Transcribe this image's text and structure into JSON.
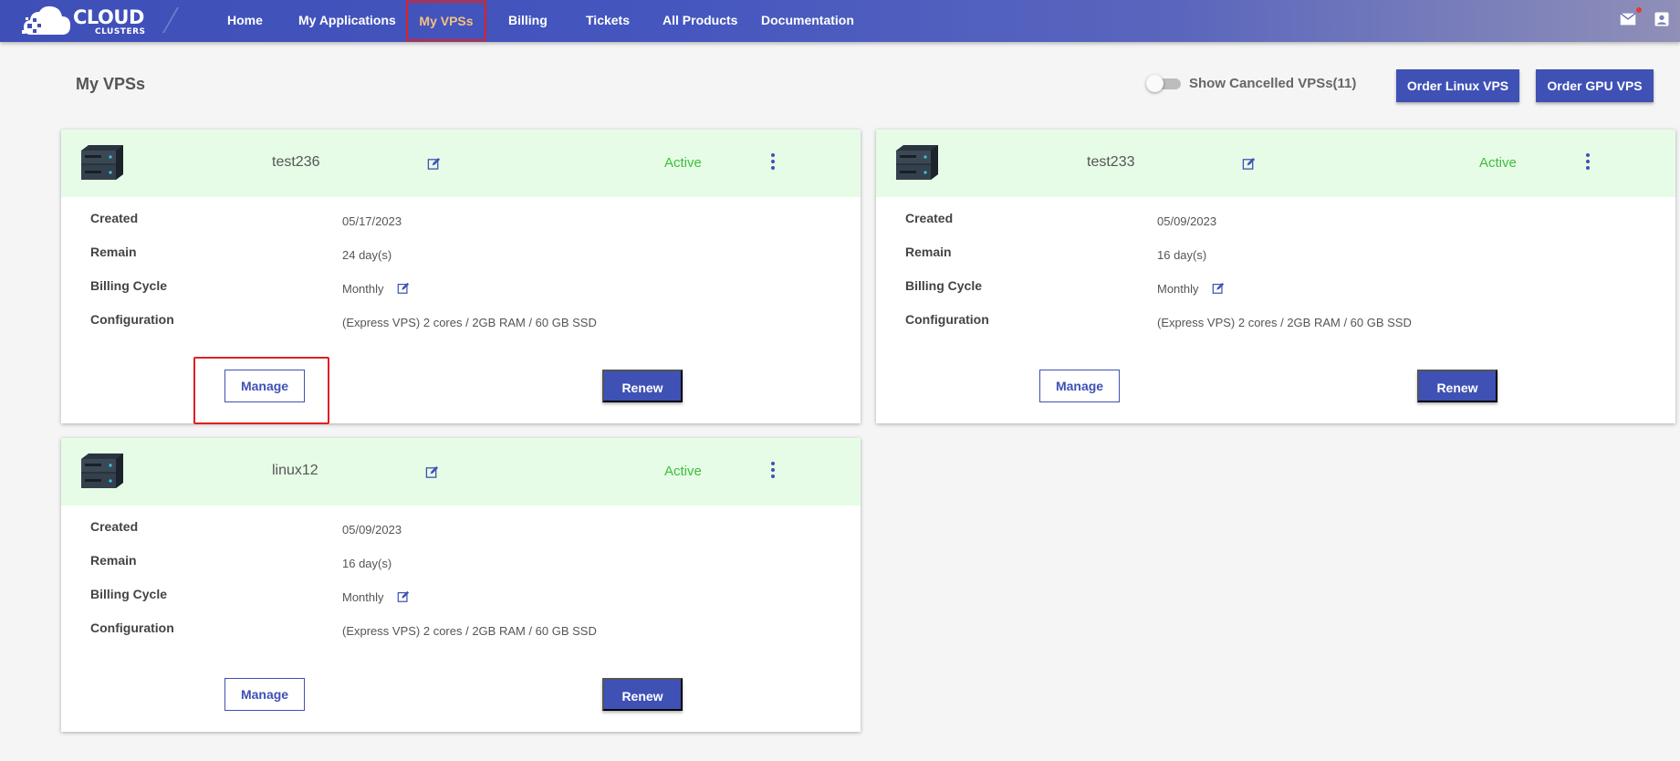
{
  "brand": {
    "name": "CLOUD",
    "sub": "CLUSTERS"
  },
  "nav": {
    "items": [
      {
        "label": "Home"
      },
      {
        "label": "My Applications"
      },
      {
        "label": "My VPSs",
        "active": true
      },
      {
        "label": "Billing"
      },
      {
        "label": "Tickets"
      },
      {
        "label": "All Products"
      },
      {
        "label": "Documentation"
      }
    ]
  },
  "page": {
    "title": "My VPSs",
    "toggle_label": "Show Cancelled VPSs(11)",
    "toggle_on": false,
    "order_linux_label": "Order Linux VPS",
    "order_gpu_label": "Order GPU VPS"
  },
  "row_labels": {
    "created": "Created",
    "remain": "Remain",
    "billing": "Billing Cycle",
    "config": "Configuration"
  },
  "buttons": {
    "manage": "Manage",
    "renew": "Renew"
  },
  "vps": [
    {
      "name": "test236",
      "status": "Active",
      "created": "05/17/2023",
      "remain": "24 day(s)",
      "billing": "Monthly",
      "config": "(Express VPS) 2 cores / 2GB RAM / 60 GB SSD"
    },
    {
      "name": "test233",
      "status": "Active",
      "created": "05/09/2023",
      "remain": "16 day(s)",
      "billing": "Monthly",
      "config": "(Express VPS) 2 cores / 2GB RAM / 60 GB SSD"
    },
    {
      "name": "linux12",
      "status": "Active",
      "created": "05/09/2023",
      "remain": "16 day(s)",
      "billing": "Monthly",
      "config": "(Express VPS) 2 cores / 2GB RAM / 60 GB SSD"
    }
  ],
  "colors": {
    "primary": "#3f51b5",
    "active_status": "#3cbf3c",
    "card_header": "#e6fce6",
    "highlight": "#e02020"
  }
}
